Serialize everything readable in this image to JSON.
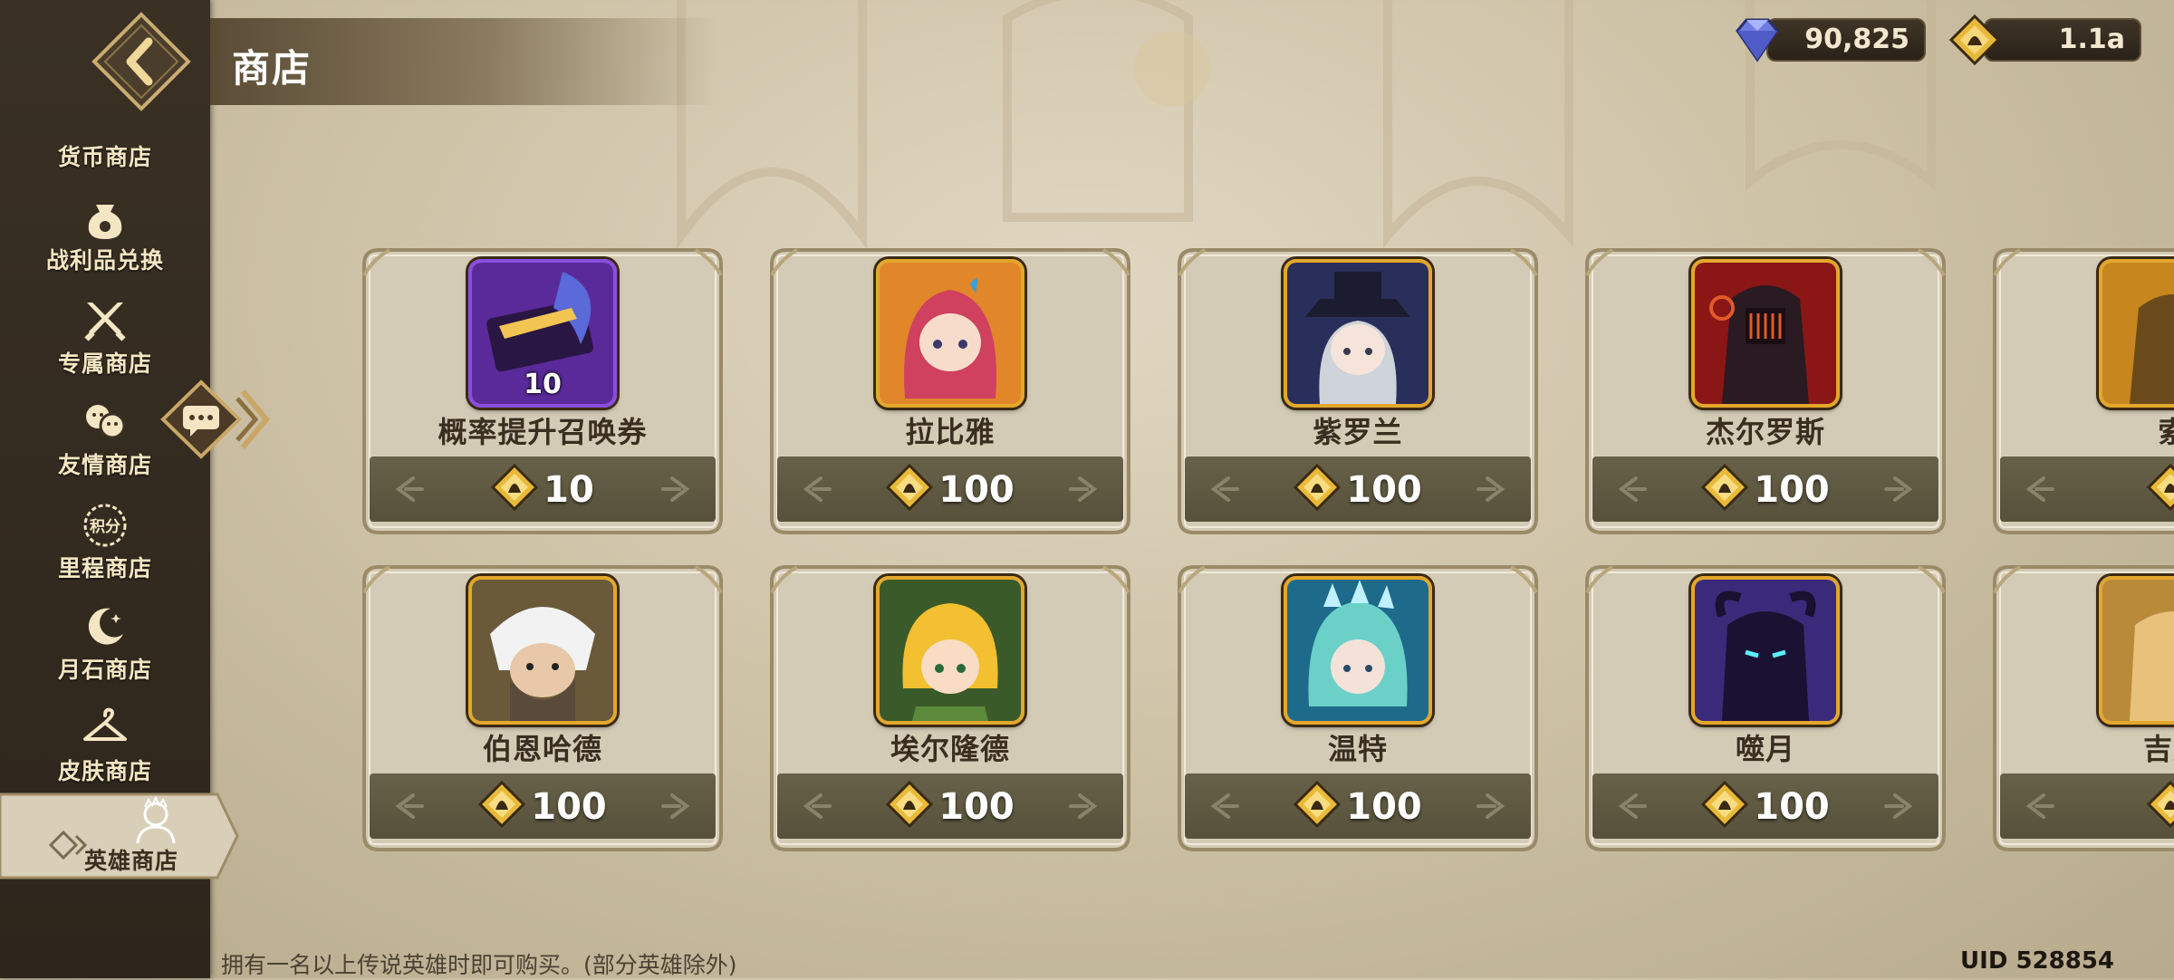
{
  "header": {
    "title": "商店"
  },
  "currency": {
    "diamonds": "90,825",
    "hero_tokens": "1.1a",
    "diamond_icon": "diamond-icon",
    "token_icon": "hero-token-icon"
  },
  "sidebar": {
    "back_icon": "back-arrow-icon",
    "items": [
      {
        "label": "货币商店",
        "icon": "currency-icon"
      },
      {
        "label": "战利品兑换",
        "icon": "loot-bag-icon"
      },
      {
        "label": "专属商店",
        "icon": "crossed-swords-icon"
      },
      {
        "label": "友情商店",
        "icon": "friends-icon"
      },
      {
        "label": "里程商店",
        "icon": "points-icon",
        "icon_text": "积分"
      },
      {
        "label": "月石商店",
        "icon": "moonstone-icon"
      },
      {
        "label": "皮肤商店",
        "icon": "hanger-icon"
      },
      {
        "label": "英雄商店",
        "icon": "hero-icon",
        "active": true
      }
    ]
  },
  "chat": {
    "icon": "chat-icon"
  },
  "shop_items": [
    {
      "name": "概率提升召唤券",
      "price": "10",
      "quantity": "10"
    },
    {
      "name": "拉比雅",
      "price": "100"
    },
    {
      "name": "紫罗兰",
      "price": "100"
    },
    {
      "name": "杰尔罗斯",
      "price": "100"
    },
    {
      "name": "索",
      "price": ""
    },
    {
      "name": "伯恩哈德",
      "price": "100"
    },
    {
      "name": "埃尔隆德",
      "price": "100"
    },
    {
      "name": "温特",
      "price": "100"
    },
    {
      "name": "噬月",
      "price": "100"
    },
    {
      "name": "吉芙",
      "price": ""
    }
  ],
  "footer": {
    "note": "拥有一名以上传说英雄时即可购买。(部分英雄除外)",
    "uid": "UID 528854"
  },
  "colors": {
    "accent_gold": "#e3a72b",
    "card_bg": "#d2c9b5",
    "price_bar": "#5e5841",
    "sidebar_bg": "#322a1f"
  }
}
